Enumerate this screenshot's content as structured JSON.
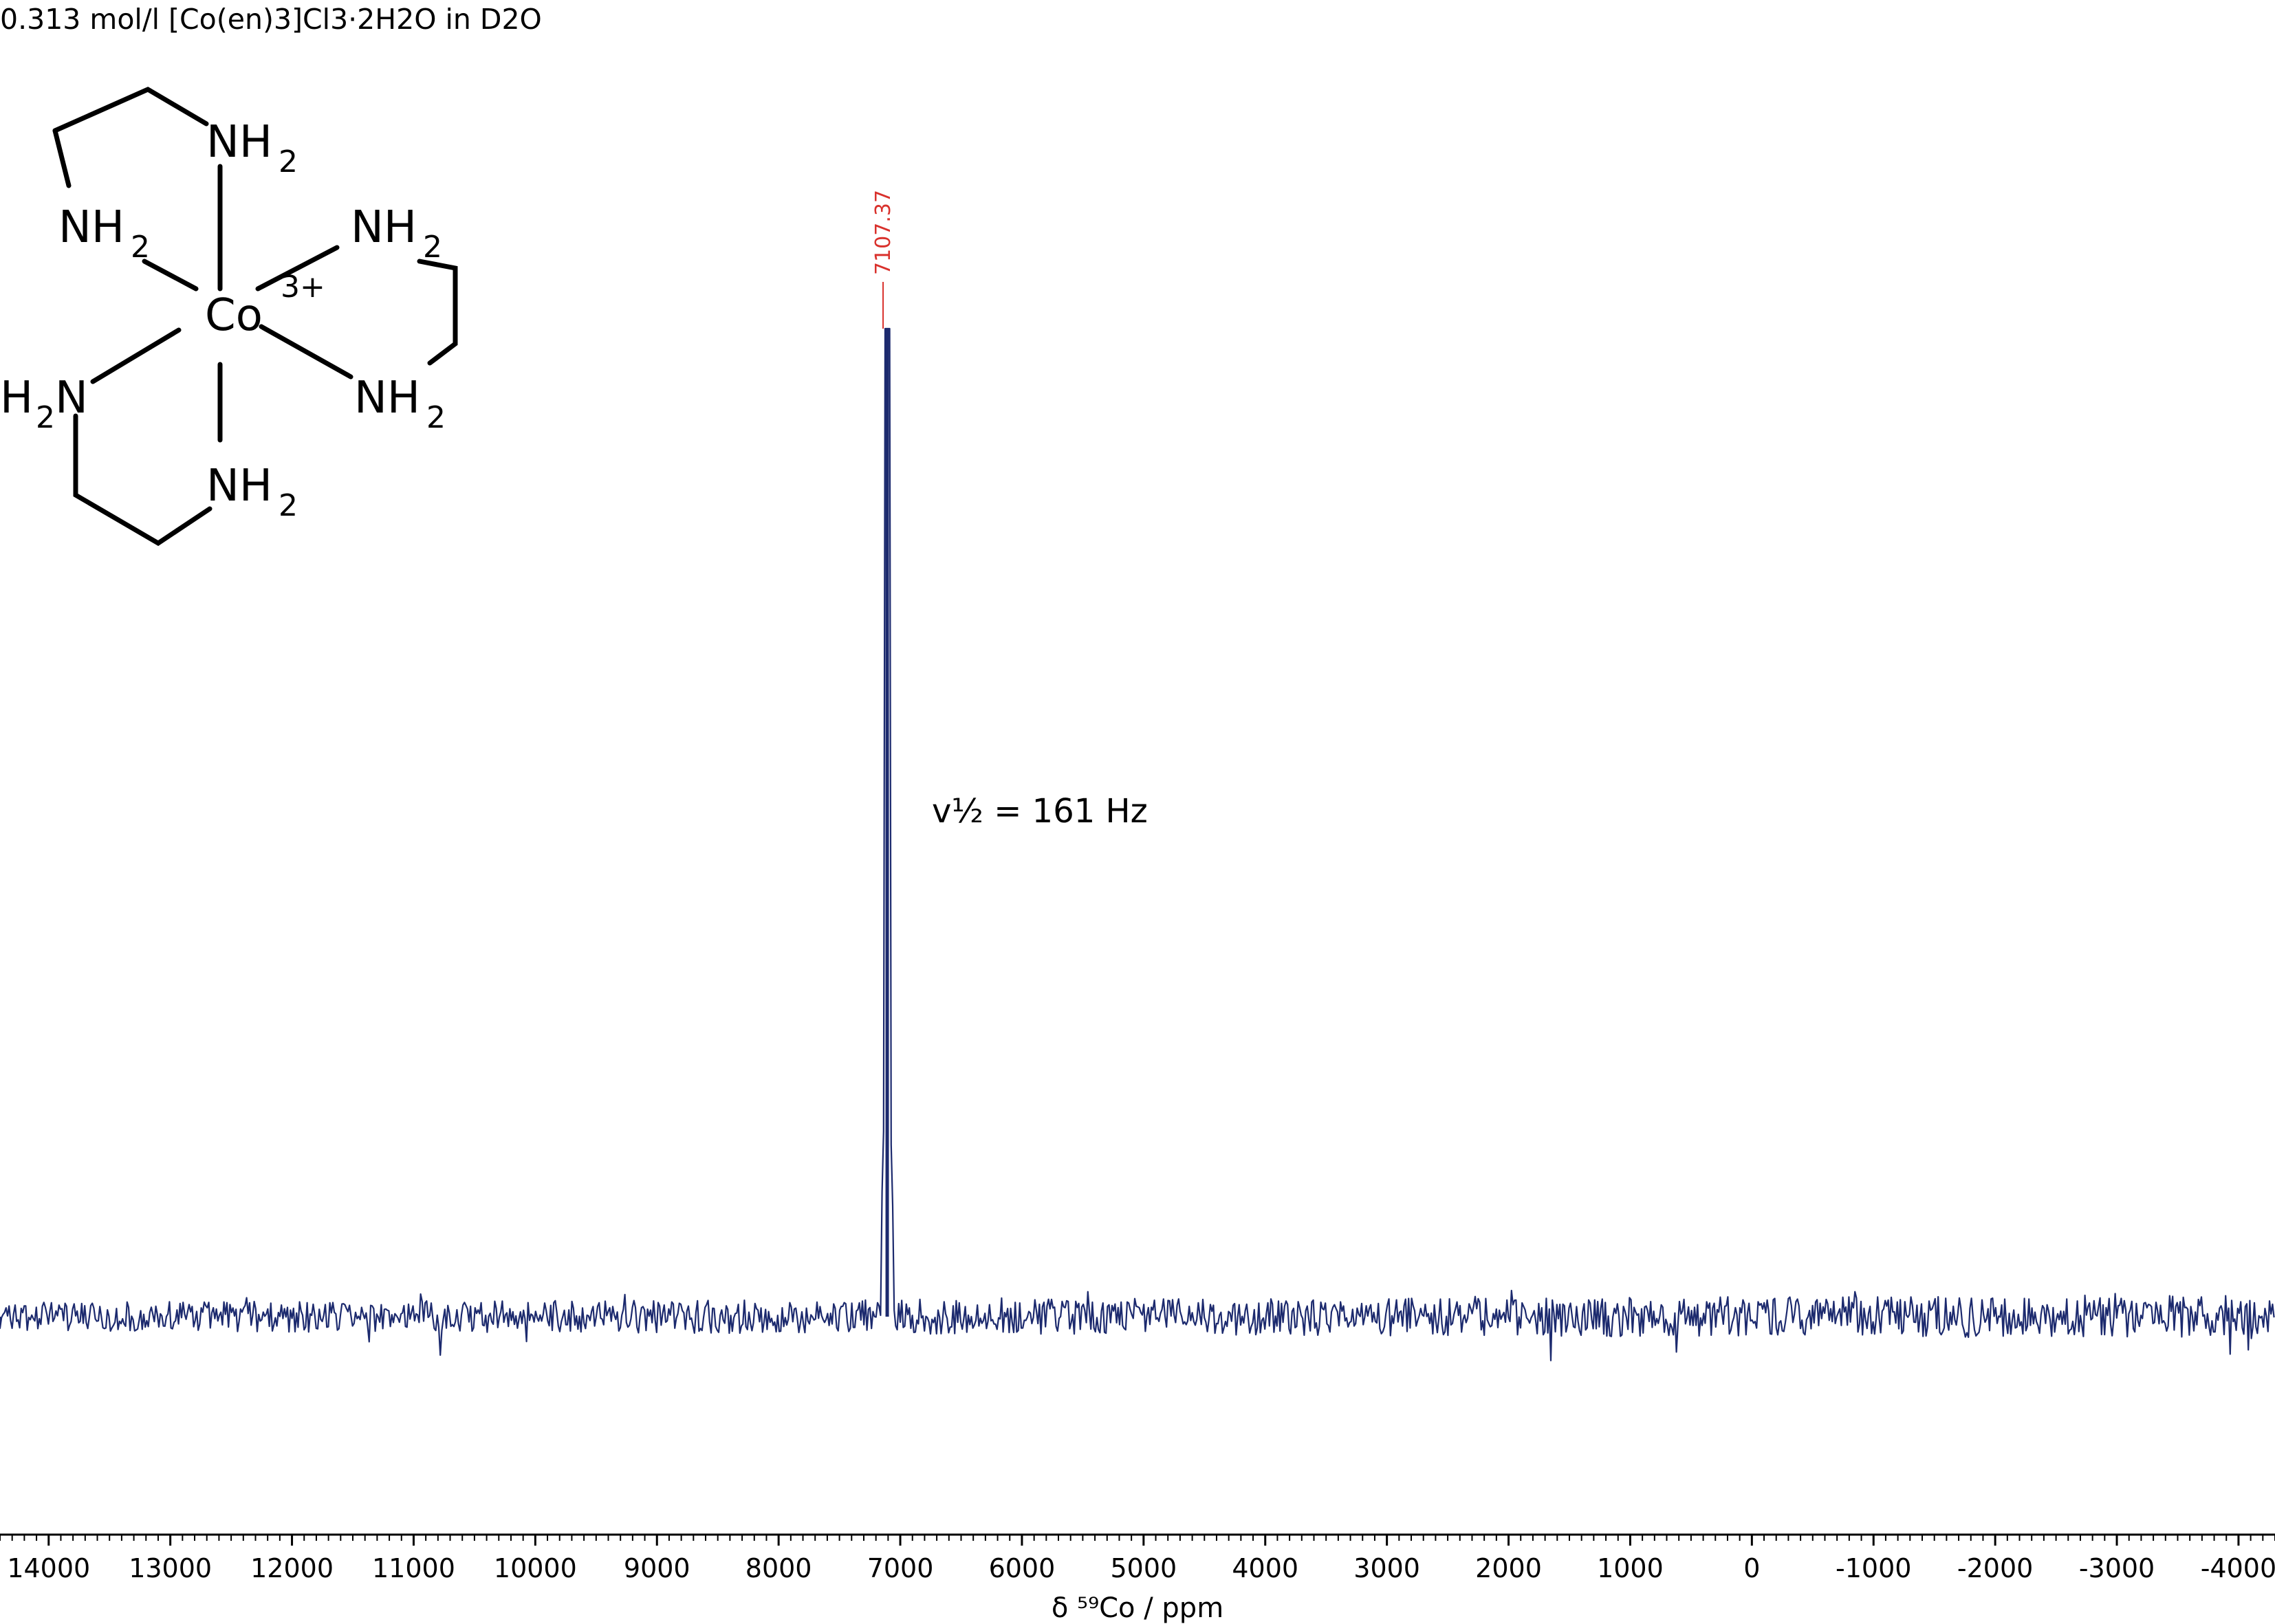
{
  "chart_data": {
    "type": "line",
    "title": "0.313 mol/l [Co(en)3]Cl3·2H2O in D2O",
    "xlabel": "δ ⁵⁹Co / ppm",
    "ylabel": "",
    "xlim": [
      14400,
      -4300
    ],
    "x_reversed": true,
    "x_ticks": [
      14000,
      13000,
      12000,
      11000,
      10000,
      9000,
      8000,
      7000,
      6000,
      5000,
      4000,
      3000,
      2000,
      1000,
      0,
      -1000,
      -2000,
      -3000,
      -4000
    ],
    "tick_labels": [
      "14000",
      "13000",
      "12000",
      "11000",
      "10000",
      "9000",
      "8000",
      "7000",
      "6000",
      "5000",
      "4000",
      "3000",
      "2000",
      "1000",
      "0",
      "-1000",
      "-2000",
      "-3000",
      "-4000"
    ],
    "grid": false,
    "series": [
      {
        "color": "#1c2a6e",
        "peaks": [
          {
            "x": 7107.37,
            "label": "7107.37",
            "label_color": "#d9312c"
          }
        ],
        "baseline": "noise"
      }
    ],
    "annotations": [
      {
        "text": "v½ = 161 Hz",
        "near_x": 6900
      }
    ]
  },
  "structure": {
    "metal": "Co",
    "charge": "3+",
    "ligands": [
      "NH",
      "NH",
      "NH",
      "NH",
      "NH",
      "H"
    ],
    "ligand_sub": "2"
  }
}
